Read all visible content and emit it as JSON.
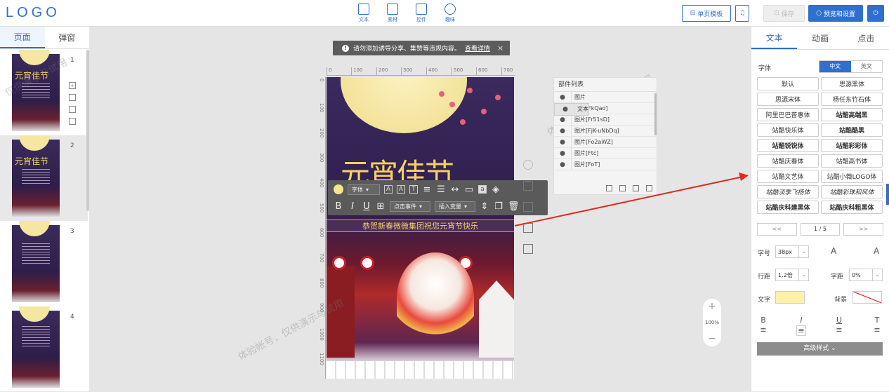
{
  "header": {
    "logo": "LOGO",
    "tools": [
      {
        "label": "文本",
        "icon": "text-icon"
      },
      {
        "label": "素材",
        "icon": "image-icon"
      },
      {
        "label": "控件",
        "icon": "widget-icon"
      },
      {
        "label": "趣味",
        "icon": "bulb-icon"
      }
    ],
    "template_btn": "单页模板",
    "save_btn": "保存",
    "preview_btn": "预览和设置"
  },
  "left_panel": {
    "tabs": [
      "页面",
      "弹窗"
    ],
    "pages": [
      {
        "num": "1",
        "title": "元宵佳节"
      },
      {
        "num": "2",
        "title": "元宵佳节"
      },
      {
        "num": "3",
        "title": ""
      },
      {
        "num": "4",
        "title": ""
      }
    ]
  },
  "notice": {
    "text": "请勿添加诱导分享、集赞等违规内容。",
    "link": "查看详情",
    "close": "×"
  },
  "ruler": {
    "h": [
      "0",
      "100",
      "200",
      "300",
      "400",
      "500",
      "600",
      "700"
    ],
    "v": [
      "0",
      "100",
      "200",
      "300",
      "400",
      "500",
      "600",
      "700",
      "800",
      "900",
      "1000",
      "1100"
    ]
  },
  "poster": {
    "title": "元宵佳节",
    "banner": "恭贺新春微微集团祝您元宵节快乐"
  },
  "watermarks": [
    "体验帐号，仅供演示与试用",
    "体验帐号，仅供演示与试用",
    "仅供演示与试用",
    "体验帐号，仅供演示与试用"
  ],
  "text_toolbar": {
    "font": "字体",
    "click_event": "点击事件",
    "insert_var": "插入变量",
    "color": "#f6e58d"
  },
  "layers": {
    "title": "部件列表",
    "items": [
      "图片",
      "文本",
      "图片[FkQao]",
      "图片[Fr51sD]",
      "图片[FjK-uNbDq]",
      "图片[Fo2aWZ]",
      "图片[Ftc]",
      "图片[FoT]"
    ]
  },
  "zoom": {
    "plus": "+",
    "value": "100%",
    "minus": "−"
  },
  "right_panel": {
    "tabs": [
      "文本",
      "动画",
      "点击"
    ],
    "font_label": "字体",
    "lang": [
      "中文",
      "英文"
    ],
    "fonts": [
      "默认",
      "思源黑体",
      "思源宋体",
      "杨任东竹石体",
      "阿里巴巴普惠体",
      "站酷高端黑",
      "站酷快乐体",
      "站酷酷黑",
      "站酷锐锐体",
      "站酷彩彩体",
      "站酷庆春体",
      "站酷高书体",
      "站酷文艺体",
      "站酷小薇LOGO体",
      "站酷淡季飞扬体",
      "站酷彩珠和风体",
      "站酷庆科建黑体",
      "站酷庆科粗黑体"
    ],
    "pager": {
      "prev": "<<",
      "page": "1 / 5",
      "next": ">>"
    },
    "size_label": "字号",
    "size_value": "38px",
    "line_label": "行距",
    "line_value": "1.2倍",
    "spacing_label": "字距",
    "spacing_value": "0%",
    "text_label": "文字",
    "bg_label": "背景",
    "text_color": "#fff2a8",
    "advanced": "高级样式"
  }
}
